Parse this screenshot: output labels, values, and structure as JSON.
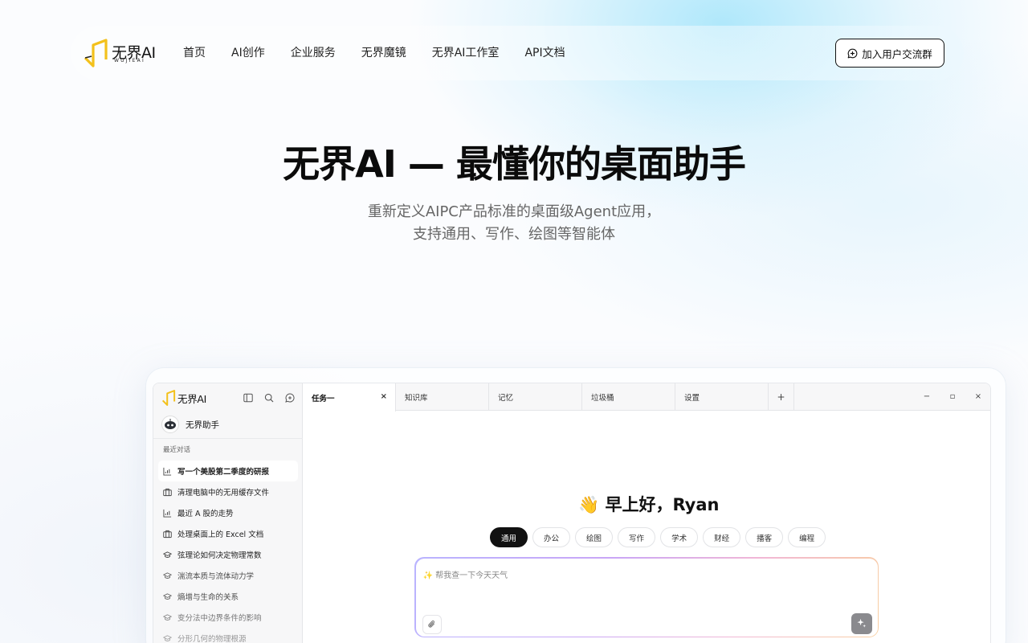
{
  "nav": {
    "logo_text": "无界AI",
    "logo_sub": "WUJIEAI",
    "links": [
      "首页",
      "AI创作",
      "企业服务",
      "无界魔镜",
      "无界AI工作室",
      "API文档"
    ],
    "join_label": "加入用户交流群"
  },
  "hero": {
    "title": "无界AI — 最懂你的桌面助手",
    "subtitle_line1": "重新定义AIPC产品标准的桌面级Agent应用，",
    "subtitle_line2": "支持通用、写作、绘图等智能体"
  },
  "app": {
    "logo_text": "无界AI",
    "assistant_name": "无界助手",
    "recent_label": "最近对话",
    "conversations": [
      {
        "label": "写一个美股第二季度的研报",
        "icon": "chart-icon"
      },
      {
        "label": "清理电脑中的无用缓存文件",
        "icon": "briefcase-icon"
      },
      {
        "label": "最近 A 股的走势",
        "icon": "chart-icon"
      },
      {
        "label": "处理桌面上的 Excel 文档",
        "icon": "briefcase-icon"
      },
      {
        "label": "弦理论如何决定物理常数",
        "icon": "graduation-cap-icon"
      },
      {
        "label": "湍流本质与流体动力学",
        "icon": "graduation-cap-icon"
      },
      {
        "label": "熵增与生命的关系",
        "icon": "graduation-cap-icon"
      },
      {
        "label": "变分法中边界条件的影响",
        "icon": "graduation-cap-icon"
      },
      {
        "label": "分形几何的物理根源",
        "icon": "graduation-cap-icon"
      }
    ],
    "tabs": [
      "任务一",
      "知识库",
      "记忆",
      "垃圾桶",
      "设置"
    ],
    "tab_close": "×",
    "tab_add": "+",
    "window_controls": [
      "−",
      "▫",
      "×"
    ],
    "greeting": "👋 早上好，Ryan",
    "chips": [
      "通用",
      "办公",
      "绘图",
      "写作",
      "学术",
      "财经",
      "播客",
      "编程"
    ],
    "input_placeholder": "✨ 帮我查一下今天天气"
  }
}
